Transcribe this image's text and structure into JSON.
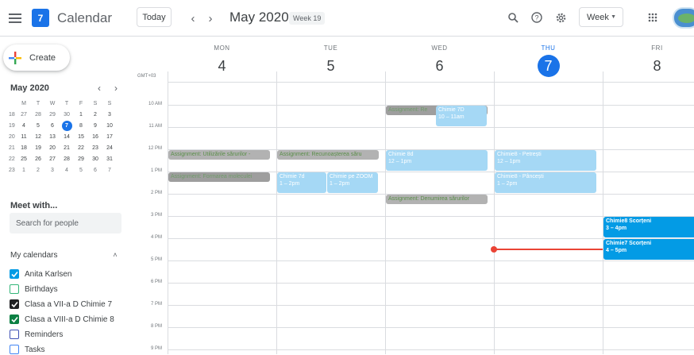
{
  "header": {
    "app_title": "Calendar",
    "logo_day": "7",
    "today_label": "Today",
    "month_label": "May 2020",
    "week_label": "Week 19",
    "view_label": "Week",
    "colors": {
      "accent": "#1a73e8",
      "now": "#ea4335"
    }
  },
  "sidebar": {
    "create_label": "Create",
    "mini_month": "May 2020",
    "mini_headers": [
      "M",
      "T",
      "W",
      "T",
      "F",
      "S",
      "S"
    ],
    "mini_weeks": [
      {
        "wk": "18",
        "days": [
          "27",
          "28",
          "29",
          "30",
          "1",
          "2",
          "3"
        ]
      },
      {
        "wk": "19",
        "days": [
          "4",
          "5",
          "6",
          "7",
          "8",
          "9",
          "10"
        ]
      },
      {
        "wk": "20",
        "days": [
          "11",
          "12",
          "13",
          "14",
          "15",
          "16",
          "17"
        ]
      },
      {
        "wk": "21",
        "days": [
          "18",
          "19",
          "20",
          "21",
          "22",
          "23",
          "24"
        ]
      },
      {
        "wk": "22",
        "days": [
          "25",
          "26",
          "27",
          "28",
          "29",
          "30",
          "31"
        ]
      },
      {
        "wk": "23",
        "days": [
          "1",
          "2",
          "3",
          "4",
          "5",
          "6",
          "7"
        ]
      }
    ],
    "selected_day": "7",
    "meet_label": "Meet with...",
    "search_placeholder": "Search for people",
    "my_calendars_label": "My calendars",
    "calendars": [
      {
        "name": "Anita Karlsen",
        "color": "#039be5",
        "checked": true
      },
      {
        "name": "Birthdays",
        "color": "#33b679",
        "checked": false
      },
      {
        "name": "Clasa a VII-a D Chimie 7",
        "color": "#202124",
        "checked": true
      },
      {
        "name": "Clasa a VIII-a D Chimie 8",
        "color": "#0b8043",
        "checked": true
      },
      {
        "name": "Reminders",
        "color": "#3f51b5",
        "checked": false
      },
      {
        "name": "Tasks",
        "color": "#4285f4",
        "checked": false
      }
    ]
  },
  "grid": {
    "timezone": "GMT+03",
    "days": [
      {
        "dow": "MON",
        "num": "4"
      },
      {
        "dow": "TUE",
        "num": "5"
      },
      {
        "dow": "WED",
        "num": "6"
      },
      {
        "dow": "THU",
        "num": "7",
        "today": true
      },
      {
        "dow": "FRI",
        "num": "8"
      }
    ],
    "hours": [
      "10 AM",
      "11 AM",
      "12 PM",
      "1 PM",
      "2 PM",
      "3 PM",
      "4 PM",
      "5 PM",
      "6 PM",
      "7 PM",
      "8 PM",
      "9 PM"
    ],
    "events": [
      {
        "title": "Assignment: Re",
        "time": "",
        "day": 2,
        "start": 10.0,
        "end": 10.5,
        "style": "gray"
      },
      {
        "title": "Chimie 7D",
        "time": "10 – 11am",
        "day": 2,
        "start": 10.0,
        "end": 11.0,
        "style": "blue",
        "half": "right"
      },
      {
        "title": "Assignment: Utilizările sărurilor -",
        "time": "",
        "day": 0,
        "start": 12.0,
        "end": 12.5,
        "style": "green"
      },
      {
        "title": "Assignment: Recunoașterea săru",
        "time": "",
        "day": 1,
        "start": 12.0,
        "end": 12.5,
        "style": "green"
      },
      {
        "title": "Chimie 8d",
        "time": "12 – 1pm",
        "day": 2,
        "start": 12.0,
        "end": 13.0,
        "style": "blue"
      },
      {
        "title": "Chimie8 - Petrești",
        "time": "12 – 1pm",
        "day": 3,
        "start": 12.0,
        "end": 13.0,
        "style": "blue"
      },
      {
        "title": "Assignment: Formarea moleculei",
        "time": "",
        "day": 0,
        "start": 13.0,
        "end": 13.5,
        "style": "gray"
      },
      {
        "title": "Chimie 7d",
        "time": "1 – 2pm",
        "day": 1,
        "start": 13.0,
        "end": 14.0,
        "style": "blue",
        "half": "left"
      },
      {
        "title": "Chimie pe ZOOM",
        "time": "1 – 2pm",
        "day": 1,
        "start": 13.0,
        "end": 14.0,
        "style": "blue",
        "half": "right"
      },
      {
        "title": "Chimie8 - Pâncești",
        "time": "1 – 2pm",
        "day": 3,
        "start": 13.0,
        "end": 14.0,
        "style": "blue"
      },
      {
        "title": "Assignment: Denumirea sărurilor",
        "time": "",
        "day": 2,
        "start": 14.0,
        "end": 14.5,
        "style": "green"
      },
      {
        "title": "Chimie8 Scorțeni",
        "time": "3 – 4pm",
        "day": 4,
        "start": 15.0,
        "end": 16.0,
        "style": "dblue"
      },
      {
        "title": "Chimie7 Scorțeni",
        "time": "4 – 5pm",
        "day": 4,
        "start": 16.0,
        "end": 17.0,
        "style": "dblue"
      }
    ],
    "now": {
      "day": 3,
      "hour": 16.5
    }
  }
}
